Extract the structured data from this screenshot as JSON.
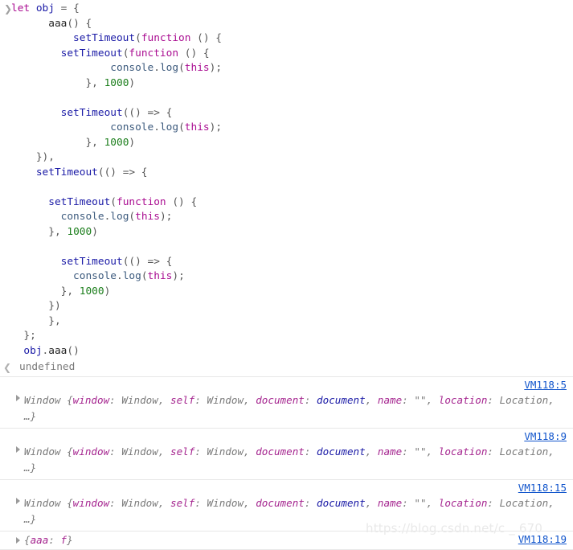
{
  "console": {
    "prompt_icon": "chevron-right",
    "result_icon": "chevron-left",
    "command_lines": [
      [
        {
          "t": "let",
          "c": "kw"
        },
        {
          "t": " ",
          "c": "plain"
        },
        {
          "t": "obj",
          "c": "ident"
        },
        {
          "t": " = {",
          "c": "punc"
        }
      ],
      [
        {
          "t": "      ",
          "c": "plain"
        },
        {
          "t": "aaa",
          "c": "plain"
        },
        {
          "t": "() {",
          "c": "punc"
        }
      ],
      [
        {
          "t": "          ",
          "c": "plain"
        },
        {
          "t": "setTimeout",
          "c": "ident"
        },
        {
          "t": "(",
          "c": "punc"
        },
        {
          "t": "function",
          "c": "kw"
        },
        {
          "t": " () {",
          "c": "punc"
        }
      ],
      [
        {
          "t": "        ",
          "c": "plain"
        },
        {
          "t": "setTimeout",
          "c": "ident"
        },
        {
          "t": "(",
          "c": "punc"
        },
        {
          "t": "function",
          "c": "kw"
        },
        {
          "t": " () {",
          "c": "punc"
        }
      ],
      [
        {
          "t": "                ",
          "c": "plain"
        },
        {
          "t": "console",
          "c": "prop"
        },
        {
          "t": ".",
          "c": "punc"
        },
        {
          "t": "log",
          "c": "prop"
        },
        {
          "t": "(",
          "c": "punc"
        },
        {
          "t": "this",
          "c": "kw"
        },
        {
          "t": ");",
          "c": "punc"
        }
      ],
      [
        {
          "t": "            ",
          "c": "plain"
        },
        {
          "t": "}, ",
          "c": "punc"
        },
        {
          "t": "1000",
          "c": "num"
        },
        {
          "t": ")",
          "c": "punc"
        }
      ],
      [],
      [
        {
          "t": "        ",
          "c": "plain"
        },
        {
          "t": "setTimeout",
          "c": "ident"
        },
        {
          "t": "(() => {",
          "c": "punc"
        }
      ],
      [
        {
          "t": "                ",
          "c": "plain"
        },
        {
          "t": "console",
          "c": "prop"
        },
        {
          "t": ".",
          "c": "punc"
        },
        {
          "t": "log",
          "c": "prop"
        },
        {
          "t": "(",
          "c": "punc"
        },
        {
          "t": "this",
          "c": "kw"
        },
        {
          "t": ");",
          "c": "punc"
        }
      ],
      [
        {
          "t": "            ",
          "c": "plain"
        },
        {
          "t": "}, ",
          "c": "punc"
        },
        {
          "t": "1000",
          "c": "num"
        },
        {
          "t": ")",
          "c": "punc"
        }
      ],
      [
        {
          "t": "    ",
          "c": "plain"
        },
        {
          "t": "}),",
          "c": "punc"
        }
      ],
      [
        {
          "t": "    ",
          "c": "plain"
        },
        {
          "t": "setTimeout",
          "c": "ident"
        },
        {
          "t": "(() => {",
          "c": "punc"
        }
      ],
      [],
      [
        {
          "t": "      ",
          "c": "plain"
        },
        {
          "t": "setTimeout",
          "c": "ident"
        },
        {
          "t": "(",
          "c": "punc"
        },
        {
          "t": "function",
          "c": "kw"
        },
        {
          "t": " () {",
          "c": "punc"
        }
      ],
      [
        {
          "t": "        ",
          "c": "plain"
        },
        {
          "t": "console",
          "c": "prop"
        },
        {
          "t": ".",
          "c": "punc"
        },
        {
          "t": "log",
          "c": "prop"
        },
        {
          "t": "(",
          "c": "punc"
        },
        {
          "t": "this",
          "c": "kw"
        },
        {
          "t": ");",
          "c": "punc"
        }
      ],
      [
        {
          "t": "      ",
          "c": "plain"
        },
        {
          "t": "}, ",
          "c": "punc"
        },
        {
          "t": "1000",
          "c": "num"
        },
        {
          "t": ")",
          "c": "punc"
        }
      ],
      [],
      [
        {
          "t": "        ",
          "c": "plain"
        },
        {
          "t": "setTimeout",
          "c": "ident"
        },
        {
          "t": "(() => {",
          "c": "punc"
        }
      ],
      [
        {
          "t": "          ",
          "c": "plain"
        },
        {
          "t": "console",
          "c": "prop"
        },
        {
          "t": ".",
          "c": "punc"
        },
        {
          "t": "log",
          "c": "prop"
        },
        {
          "t": "(",
          "c": "punc"
        },
        {
          "t": "this",
          "c": "kw"
        },
        {
          "t": ");",
          "c": "punc"
        }
      ],
      [
        {
          "t": "        ",
          "c": "plain"
        },
        {
          "t": "}, ",
          "c": "punc"
        },
        {
          "t": "1000",
          "c": "num"
        },
        {
          "t": ")",
          "c": "punc"
        }
      ],
      [
        {
          "t": "      ",
          "c": "plain"
        },
        {
          "t": "})",
          "c": "punc"
        }
      ],
      [
        {
          "t": "      ",
          "c": "plain"
        },
        {
          "t": "},",
          "c": "punc"
        }
      ],
      [
        {
          "t": "  ",
          "c": "plain"
        },
        {
          "t": "};",
          "c": "punc"
        }
      ],
      [
        {
          "t": "  ",
          "c": "plain"
        },
        {
          "t": "obj",
          "c": "ident"
        },
        {
          "t": ".",
          "c": "punc"
        },
        {
          "t": "aaa",
          "c": "plain"
        },
        {
          "t": "()",
          "c": "punc"
        }
      ]
    ],
    "result_value": "undefined",
    "log_rows": [
      {
        "source": "VM118:5",
        "expandable": true,
        "parts": [
          {
            "t": "Window ",
            "c": "obj-name"
          },
          {
            "t": "{",
            "c": "obj-brace"
          },
          {
            "t": "window",
            "c": "obj-key"
          },
          {
            "t": ": ",
            "c": "obj-val"
          },
          {
            "t": "Window",
            "c": "obj-val"
          },
          {
            "t": ", ",
            "c": "obj-val"
          },
          {
            "t": "self",
            "c": "obj-key"
          },
          {
            "t": ": ",
            "c": "obj-val"
          },
          {
            "t": "Window",
            "c": "obj-val"
          },
          {
            "t": ", ",
            "c": "obj-val"
          },
          {
            "t": "document",
            "c": "obj-key"
          },
          {
            "t": ": ",
            "c": "obj-val"
          },
          {
            "t": "document",
            "c": "obj-node"
          },
          {
            "t": ", ",
            "c": "obj-val"
          },
          {
            "t": "name",
            "c": "obj-key"
          },
          {
            "t": ": ",
            "c": "obj-val"
          },
          {
            "t": "\"\"",
            "c": "obj-val"
          },
          {
            "t": ", ",
            "c": "obj-val"
          },
          {
            "t": "location",
            "c": "obj-key"
          },
          {
            "t": ": ",
            "c": "obj-val"
          },
          {
            "t": "Location",
            "c": "obj-val"
          },
          {
            "t": ", …",
            "c": "obj-val"
          },
          {
            "t": "}",
            "c": "obj-brace"
          }
        ]
      },
      {
        "source": "VM118:9",
        "expandable": true,
        "parts": [
          {
            "t": "Window ",
            "c": "obj-name"
          },
          {
            "t": "{",
            "c": "obj-brace"
          },
          {
            "t": "window",
            "c": "obj-key"
          },
          {
            "t": ": ",
            "c": "obj-val"
          },
          {
            "t": "Window",
            "c": "obj-val"
          },
          {
            "t": ", ",
            "c": "obj-val"
          },
          {
            "t": "self",
            "c": "obj-key"
          },
          {
            "t": ": ",
            "c": "obj-val"
          },
          {
            "t": "Window",
            "c": "obj-val"
          },
          {
            "t": ", ",
            "c": "obj-val"
          },
          {
            "t": "document",
            "c": "obj-key"
          },
          {
            "t": ": ",
            "c": "obj-val"
          },
          {
            "t": "document",
            "c": "obj-node"
          },
          {
            "t": ", ",
            "c": "obj-val"
          },
          {
            "t": "name",
            "c": "obj-key"
          },
          {
            "t": ": ",
            "c": "obj-val"
          },
          {
            "t": "\"\"",
            "c": "obj-val"
          },
          {
            "t": ", ",
            "c": "obj-val"
          },
          {
            "t": "location",
            "c": "obj-key"
          },
          {
            "t": ": ",
            "c": "obj-val"
          },
          {
            "t": "Location",
            "c": "obj-val"
          },
          {
            "t": ", …",
            "c": "obj-val"
          },
          {
            "t": "}",
            "c": "obj-brace"
          }
        ]
      },
      {
        "source": "VM118:15",
        "expandable": true,
        "parts": [
          {
            "t": "Window ",
            "c": "obj-name"
          },
          {
            "t": "{",
            "c": "obj-brace"
          },
          {
            "t": "window",
            "c": "obj-key"
          },
          {
            "t": ": ",
            "c": "obj-val"
          },
          {
            "t": "Window",
            "c": "obj-val"
          },
          {
            "t": ", ",
            "c": "obj-val"
          },
          {
            "t": "self",
            "c": "obj-key"
          },
          {
            "t": ": ",
            "c": "obj-val"
          },
          {
            "t": "Window",
            "c": "obj-val"
          },
          {
            "t": ", ",
            "c": "obj-val"
          },
          {
            "t": "document",
            "c": "obj-key"
          },
          {
            "t": ": ",
            "c": "obj-val"
          },
          {
            "t": "document",
            "c": "obj-node"
          },
          {
            "t": ", ",
            "c": "obj-val"
          },
          {
            "t": "name",
            "c": "obj-key"
          },
          {
            "t": ": ",
            "c": "obj-val"
          },
          {
            "t": "\"\"",
            "c": "obj-val"
          },
          {
            "t": ", ",
            "c": "obj-val"
          },
          {
            "t": "location",
            "c": "obj-key"
          },
          {
            "t": ": ",
            "c": "obj-val"
          },
          {
            "t": "Location",
            "c": "obj-val"
          },
          {
            "t": ", …",
            "c": "obj-val"
          },
          {
            "t": "}",
            "c": "obj-brace"
          }
        ]
      },
      {
        "source": "VM118:19",
        "expandable": true,
        "compact": true,
        "parts": [
          {
            "t": "{",
            "c": "obj-brace"
          },
          {
            "t": "aaa",
            "c": "obj-key"
          },
          {
            "t": ": ",
            "c": "obj-val"
          },
          {
            "t": "f",
            "c": "obj-fn"
          },
          {
            "t": "}",
            "c": "obj-brace"
          }
        ]
      }
    ]
  },
  "watermark": {
    "text": "https://blog.csdn.net/c    _    670"
  }
}
